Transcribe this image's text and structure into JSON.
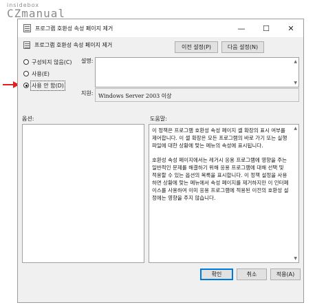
{
  "watermark": {
    "top": "insidebox",
    "brand": "CZmanual"
  },
  "window": {
    "title": "프로그램 호환성 속성 페이지 제거",
    "controls": {
      "minimize": "—",
      "maximize": "☐",
      "close": "✕"
    }
  },
  "header": {
    "setting_name": "프로그램 호환성 속성 페이지 제거"
  },
  "nav": {
    "prev_label": "이전 설정(P)",
    "next_label": "다음 설정(N)"
  },
  "state": {
    "options": [
      {
        "label": "구성되지 않음(C)",
        "checked": false
      },
      {
        "label": "사용(E)",
        "checked": false
      },
      {
        "label": "사용 안 함(D)",
        "checked": true
      }
    ]
  },
  "comment": {
    "label": "설명:",
    "value": ""
  },
  "supported": {
    "label": "지원:",
    "value": "Windows Server 2003 이상"
  },
  "options_panel": {
    "label": "옵션:"
  },
  "help": {
    "label": "도움말:",
    "paragraphs": [
      "이 정책은 프로그램 호환성 속성 페이지 셸 확장의 표시 여부를 제어합니다. 이 셸 확장은 모든 프로그램의 바로 가기 또는 실행 파일에 대한 상황에 맞는 메뉴의 속성에 표시됩니다.",
      "호환성 속성 페이지에서는 레거시 응용 프로그램에 영향을 주는 일반적인 문제를 해결하기 위해 응용 프로그램에 대해 선택 및 적용할 수 있는 옵션의 목록을 표시합니다. 이 정책 설정을 사용하면 상황에 맞는 메뉴에서 속성 페이지를 제거하지만 이 인터페이스를 사용하여 이미 응용 프로그램에 적용된 이전의 호환성 설정에는 영향을 주지 않습니다."
    ]
  },
  "footer": {
    "ok_label": "확인",
    "cancel_label": "취소",
    "apply_label": "적용(A)"
  },
  "colors": {
    "arrow": "#e02020",
    "accent": "#0078d7",
    "dialog_bg": "#f0f0f0"
  },
  "icons": {
    "window": "policy-doc-icon",
    "arrow": "red-arrow-icon"
  }
}
